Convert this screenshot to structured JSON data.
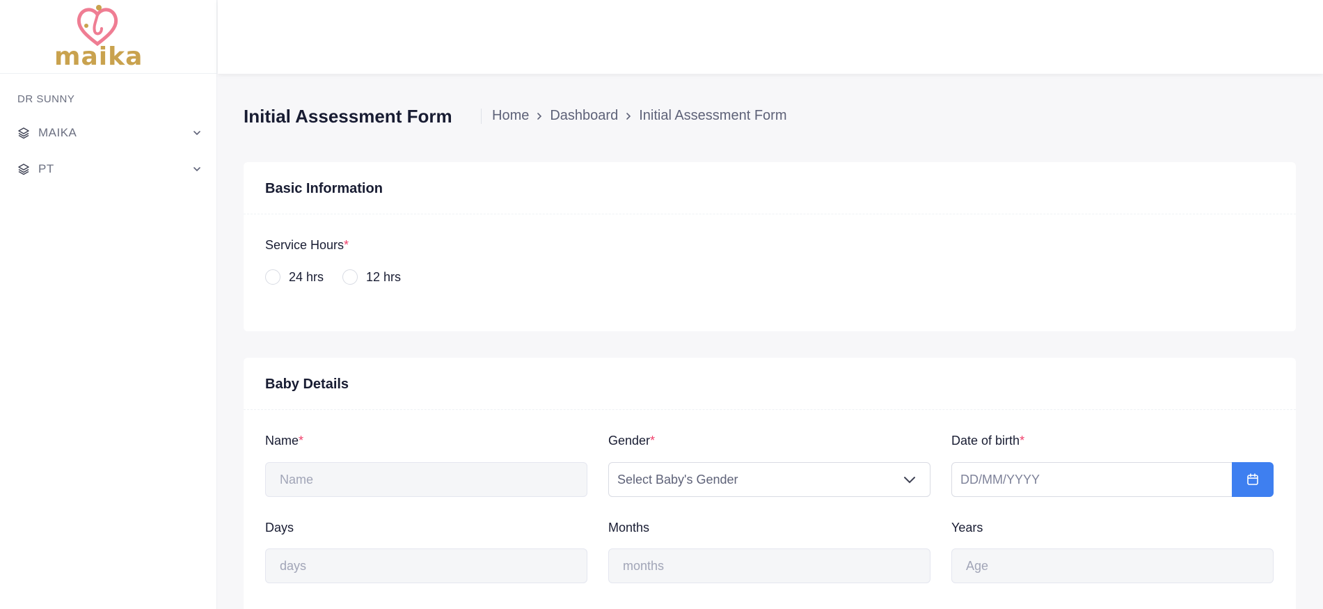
{
  "brand": {
    "logo_text": "maika",
    "logo_color": "#c9a24e",
    "heart_color": "#ef7d93"
  },
  "sidebar": {
    "user_name": "DR SUNNY",
    "items": [
      {
        "label": "MAIKA",
        "icon": "layers-icon"
      },
      {
        "label": "PT",
        "icon": "layers-icon"
      }
    ]
  },
  "page": {
    "title": "Initial Assessment Form",
    "breadcrumb": [
      "Home",
      "Dashboard",
      "Initial Assessment Form"
    ]
  },
  "basic_info": {
    "title": "Basic Information",
    "service_hours_label": "Service Hours",
    "required_mark": "*",
    "options": [
      "24 hrs",
      "12 hrs"
    ]
  },
  "baby_details": {
    "title": "Baby Details",
    "name_label": "Name",
    "name_placeholder": "Name",
    "gender_label": "Gender",
    "gender_placeholder": "Select Baby's Gender",
    "dob_label": "Date of birth",
    "dob_placeholder": "DD/MM/YYYY",
    "days_label": "Days",
    "days_placeholder": "days",
    "months_label": "Months",
    "months_placeholder": "months",
    "years_label": "Years",
    "years_placeholder": "Age"
  },
  "colors": {
    "accent": "#3e7ff0",
    "required": "#f1416c"
  }
}
